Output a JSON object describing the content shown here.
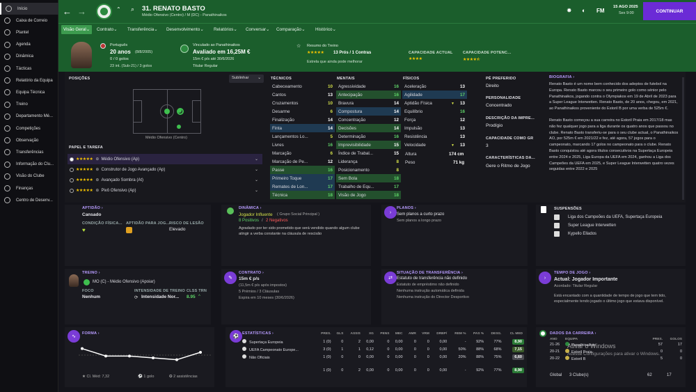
{
  "sidebar": {
    "items": [
      {
        "label": "Início",
        "icon": "home-icon"
      },
      {
        "label": "Caixa de Correio",
        "icon": "mail-icon"
      },
      {
        "label": "Plantel",
        "icon": "squad-icon"
      },
      {
        "label": "Agenda",
        "icon": "calendar-icon"
      },
      {
        "label": "Dinâmica",
        "icon": "dynamics-icon"
      },
      {
        "label": "Tácticas",
        "icon": "tactics-icon"
      },
      {
        "label": "Relatório da Equipa",
        "icon": "report-icon"
      },
      {
        "label": "Equipa Técnica",
        "icon": "staff-icon"
      },
      {
        "label": "Treino",
        "icon": "training-icon"
      },
      {
        "label": "Departamento Mé...",
        "icon": "medical-icon"
      },
      {
        "label": "Competições",
        "icon": "trophy-icon"
      },
      {
        "label": "Observação",
        "icon": "scouting-icon"
      },
      {
        "label": "Transferências",
        "icon": "transfer-icon"
      },
      {
        "label": "Informação do Clu...",
        "icon": "info-icon"
      },
      {
        "label": "Visão do Clube",
        "icon": "vision-icon"
      },
      {
        "label": "Finanças",
        "icon": "finance-icon"
      },
      {
        "label": "Centro de Desenv...",
        "icon": "development-icon"
      }
    ]
  },
  "header": {
    "player_number_name": "31. RENATO BASTO",
    "subtitle": "Médio Ofensivo (Centro) / M (DC) - Panathinaikos",
    "date": "15 AGO 2025",
    "time": "Sex 9:00",
    "continue_label": "CONTINUAR",
    "fm_label": "FM"
  },
  "tabs": [
    "Visão Geral",
    "Contrato",
    "Transferência",
    "Desenvolvimento",
    "Relatórios",
    "Conversar",
    "Comparação",
    "Histórico"
  ],
  "profile": {
    "nationality": "Português",
    "age": "20 anos",
    "dob": "(8/8/2005)",
    "apps": "0 / 0 golos",
    "u21": "23 int. (Sub-21) / 3 golos",
    "loaned_from": "Vinculado ao Panathinaikos",
    "value": "Avaliado em 16,25M €",
    "wage": "15m € p/s até 30/6/2026",
    "status": "Titular Regular",
    "training_summary_label": "Resumo do Treino",
    "training_pros": "13 Prós / 1 Contras",
    "training_note": "Estrela que ainda pode melhorar",
    "ca_label": "CAPACIDADE ACTUAL",
    "pa_label": "CAPACIDADE POTENC...",
    "ca_stars": 4,
    "pa_stars": 4.5
  },
  "positions": {
    "title": "POSIÇÕES",
    "highlight_label": "Sublinhar",
    "position_name": "Médio Ofensivo (Centro)",
    "roles_title": "PAPEL E TAREFA",
    "roles": [
      {
        "label": "Médio Ofensivo (Ap)",
        "selected": true
      },
      {
        "label": "Construtor de Jogo Avançado (Ap)",
        "selected": false
      },
      {
        "label": "Avançado Sombra (At)",
        "selected": false
      },
      {
        "label": "Pivô Ofensivo (Ap)",
        "selected": false
      }
    ]
  },
  "attributes": {
    "technical_title": "TÉCNICOS",
    "mental_title": "MENTAIS",
    "physical_title": "FÍSICOS",
    "technical": [
      {
        "name": "Cabeceamento",
        "value": "10",
        "hl": ""
      },
      {
        "name": "Cantos",
        "value": "13",
        "hl": ""
      },
      {
        "name": "Cruzamentos",
        "value": "10",
        "hl": ""
      },
      {
        "name": "Desarme",
        "value": "6",
        "hl": ""
      },
      {
        "name": "Finalização",
        "value": "14",
        "hl": ""
      },
      {
        "name": "Finta",
        "value": "14",
        "hl": "hl"
      },
      {
        "name": "Lançamentos Lo...",
        "value": "5",
        "hl": ""
      },
      {
        "name": "Livres",
        "value": "16",
        "hl": ""
      },
      {
        "name": "Marcação",
        "value": "6",
        "hl": ""
      },
      {
        "name": "Marcação de Pe...",
        "value": "12",
        "hl": ""
      },
      {
        "name": "Passe",
        "value": "16",
        "hl": "gr"
      },
      {
        "name": "Primeiro Toque",
        "value": "17",
        "hl": "hl"
      },
      {
        "name": "Remates de Lon...",
        "value": "17",
        "hl": "hl"
      },
      {
        "name": "Técnica",
        "value": "18",
        "hl": "gr"
      }
    ],
    "mental": [
      {
        "name": "Agressividade",
        "value": "16",
        "hl": ""
      },
      {
        "name": "Antecipação",
        "value": "16",
        "hl": "gr"
      },
      {
        "name": "Bravura",
        "value": "14",
        "hl": ""
      },
      {
        "name": "Compostura",
        "value": "14",
        "hl": "hl"
      },
      {
        "name": "Concentração",
        "value": "12",
        "hl": ""
      },
      {
        "name": "Decisões",
        "value": "14",
        "hl": "gr"
      },
      {
        "name": "Determinação",
        "value": "16",
        "hl": ""
      },
      {
        "name": "Imprevisibilidade",
        "value": "15",
        "hl": "gr"
      },
      {
        "name": "Índice de Trabal...",
        "value": "15",
        "hl": ""
      },
      {
        "name": "Liderança",
        "value": "8",
        "hl": ""
      },
      {
        "name": "Posicionamento",
        "value": "8",
        "hl": ""
      },
      {
        "name": "Sem Bola",
        "value": "18",
        "hl": "gr"
      },
      {
        "name": "Trabalho de Equ...",
        "value": "17",
        "hl": ""
      },
      {
        "name": "Visão de Jogo",
        "value": "18",
        "hl": "gr"
      }
    ],
    "physical": [
      {
        "name": "Aceleração",
        "value": "13",
        "hl": "",
        "arrow": ""
      },
      {
        "name": "Agilidade",
        "value": "17",
        "hl": "hl",
        "arrow": ""
      },
      {
        "name": "Aptidão Física",
        "value": "13",
        "hl": "",
        "arrow": "▼"
      },
      {
        "name": "Equilíbrio",
        "value": "16",
        "hl": "",
        "arrow": ""
      },
      {
        "name": "Força",
        "value": "12",
        "hl": "",
        "arrow": ""
      },
      {
        "name": "Impulsão",
        "value": "13",
        "hl": "",
        "arrow": ""
      },
      {
        "name": "Resistência",
        "value": "13",
        "hl": "",
        "arrow": ""
      },
      {
        "name": "Velocidade",
        "value": "13",
        "hl": "",
        "arrow": "▼"
      }
    ],
    "height_label": "Altura",
    "height": "174 cm",
    "weight_label": "Peso",
    "weight": "71 kg"
  },
  "info": {
    "foot_label": "PÉ PREFERIDO",
    "foot": "Direito",
    "personality_label": "PERSONALIDADE",
    "personality": "Concentrado",
    "media_label": "DESCRIÇÃO DA IMPRE...",
    "media": "Prodígio",
    "capacity_label": "CAPACIDADE COMO GR",
    "capacity": "3",
    "traits_label": "CARACTERÍSTICAS DA...",
    "traits": "Gere o Ritmo de Jogo"
  },
  "bio": {
    "title": "BIOGRAFIA",
    "p1": "Renato Basto é um nome bem conhecido dos adeptos de futebol na Europa. Renato Basto marcou o seu primeiro golo como sénior pelo Panathinaikos, jogando contra o Olympiakos em 19 de Abril de 2023 para a Super League Interwetten. Renato Basto, de 20 anos, chegou, em 2021, ao Panathinaikos proveniente do Estoril B por uma verba de 525m €.",
    "p2": "Renato Basto começou a sua carreira no Estoril Praia em 2017/18 mas não fez qualquer jogo para a liga durante os quatro anos que passou no clube. Renato Basto transferiu-se para o seu clube actual, o Panathinaikos AO, por 525m € em 2021/22 e fez, até agora, 57 jogos para o campeonato, marcando 17 golos no campeonato para o clube. Renato Basto conquistou até agora títulos consecutivos na Supertaça Europeia entre 2024 e 2025, Liga Europa da UEFA em 2024, ganhou a Liga dos Campeões da UEFA em 2025, e Super League Interwetten quatro vezes seguidas entre 2022 e 2025"
  },
  "row2": {
    "fitness_label": "APTIDÃO",
    "fitness": "Cansado",
    "physical_cond_label": "CONDIÇÃO FÍSICA...",
    "match_sharp_label": "APTIDÃO PARA JOG...",
    "injury_risk_label": "RISCO DE LESÃO",
    "injury_risk": "Elevado",
    "dynamics_label": "DINÂMICA",
    "dynamics_role": "Jogador Influente",
    "dynamics_group": "( Grupo Social Principal )",
    "dyn_pos": "8 Positivos",
    "dyn_sep": "/",
    "dyn_neg": "2 Negativos",
    "dyn_text": "Agradado por ter sido prometido que será vendido quando algum clube atingir a verba constante na cláusula de rescisão",
    "plans_label": "PLANOS",
    "plans_short": "Sem planos a curto prazo",
    "plans_long": "Sem planos a longo prazo",
    "suspensions_label": "SUSPENSÕES",
    "suspensions": [
      "Liga dos Campeões da UEFA, Supertaça Europeia",
      "Super League Interwetten",
      "Kypello Ellados"
    ]
  },
  "row3": {
    "training_label": "TREINO",
    "training_role": "MO (C) - Médio Ofensivo (Apoiar)",
    "focus_label": "FOCO",
    "focus": "Nenhum",
    "intensity_label": "INTENSIDADE DE TREINO",
    "intensity": "Intensidade Nor...",
    "rating_label": "CLSS TRN",
    "rating": "8.95",
    "contract_label": "CONTRATO",
    "contract_wage": "15m € p/s",
    "contract_wage_note": "(11,5m € p/s após impostos)",
    "contract_bonus": "5 Prémios / 3 Cláusulas",
    "contract_exp": "Expira em 10 meses (30/6/2026)",
    "transfer_label": "SITUAÇÃO DE TRANSFERÊNCIA",
    "transfer_status": "Estatuto de transferência não definido",
    "loan_status": "Estatuto de empréstimo não definido",
    "transfer_note1": "Nenhuma instrução automática definida",
    "transfer_note2": "Nenhuma instrução do Director Desportivo",
    "playtime_label": "TEMPO DE JOGO",
    "playtime": "Actual: Jogador Importante",
    "playtime_agreed": "Acordado: Titular Regular",
    "playtime_text": "Está encantado com a quantidade de tempo de jogo que tem tido, especialmente tendo jogado o último jogo que estava disponível."
  },
  "form": {
    "label": "FORMA",
    "avg": "Cl. Méd: 7,32",
    "goals": "1 golo",
    "assists": "2 assistências",
    "values": [
      7.6,
      7.2,
      7.2,
      7.1,
      7.0,
      7.4
    ]
  },
  "stats": {
    "label": "ESTATÍSTICAS",
    "columns": [
      "PRES.",
      "GLS",
      "ASSIS",
      "XG",
      "PENS",
      "MEC",
      "AMR",
      "VRM",
      "DRBP/",
      "REM %",
      "PAS %",
      "DESG.",
      "CL MED"
    ],
    "rows": [
      {
        "comp": "Supertaça Europeia",
        "vals": [
          "1 (0)",
          "0",
          "2",
          "0,00",
          "0",
          "0,00",
          "0",
          "0",
          "0,00",
          "-",
          "92%",
          "77%"
        ],
        "rating": "8,90"
      },
      {
        "comp": "UEFA Campeonato Europe...",
        "vals": [
          "3 (0)",
          "1",
          "1",
          "0,12",
          "0",
          "0,00",
          "0",
          "0",
          "0,00",
          "50%",
          "88%",
          "68%"
        ],
        "rating": "7,15"
      },
      {
        "comp": "Não Oficiais",
        "vals": [
          "1 (0)",
          "0",
          "0",
          "0,00",
          "0",
          "0,00",
          "0",
          "0",
          "0,00",
          "20%",
          "88%",
          "75%"
        ],
        "rating": "6,60"
      }
    ],
    "total": {
      "vals": [
        "1 (0)",
        "0",
        "2",
        "0,00",
        "0",
        "0,00",
        "0",
        "0",
        "0,00",
        "-",
        "92%",
        "77%"
      ],
      "rating": "8,90"
    }
  },
  "career": {
    "label": "DADOS DA CARREIRA",
    "columns": [
      "ANO",
      "EQUIPA",
      "PRES.",
      "GOLOS"
    ],
    "rows": [
      {
        "year": "21-26",
        "team": "Panathinaikos",
        "apps": "57",
        "goals": "17"
      },
      {
        "year": "20-21",
        "team": "Estoril Praia",
        "apps": "0",
        "goals": "0"
      },
      {
        "year": "20-22",
        "team": "Estoril B",
        "apps": "5",
        "goals": "0"
      }
    ],
    "total_label": "Global",
    "total_clubs": "3 Clube(s)",
    "total_apps": "62",
    "total_goals": "17"
  },
  "watermark": {
    "line1": "Ativar o Windows",
    "line2": "Acesse Configurações para ativar o Windows."
  }
}
